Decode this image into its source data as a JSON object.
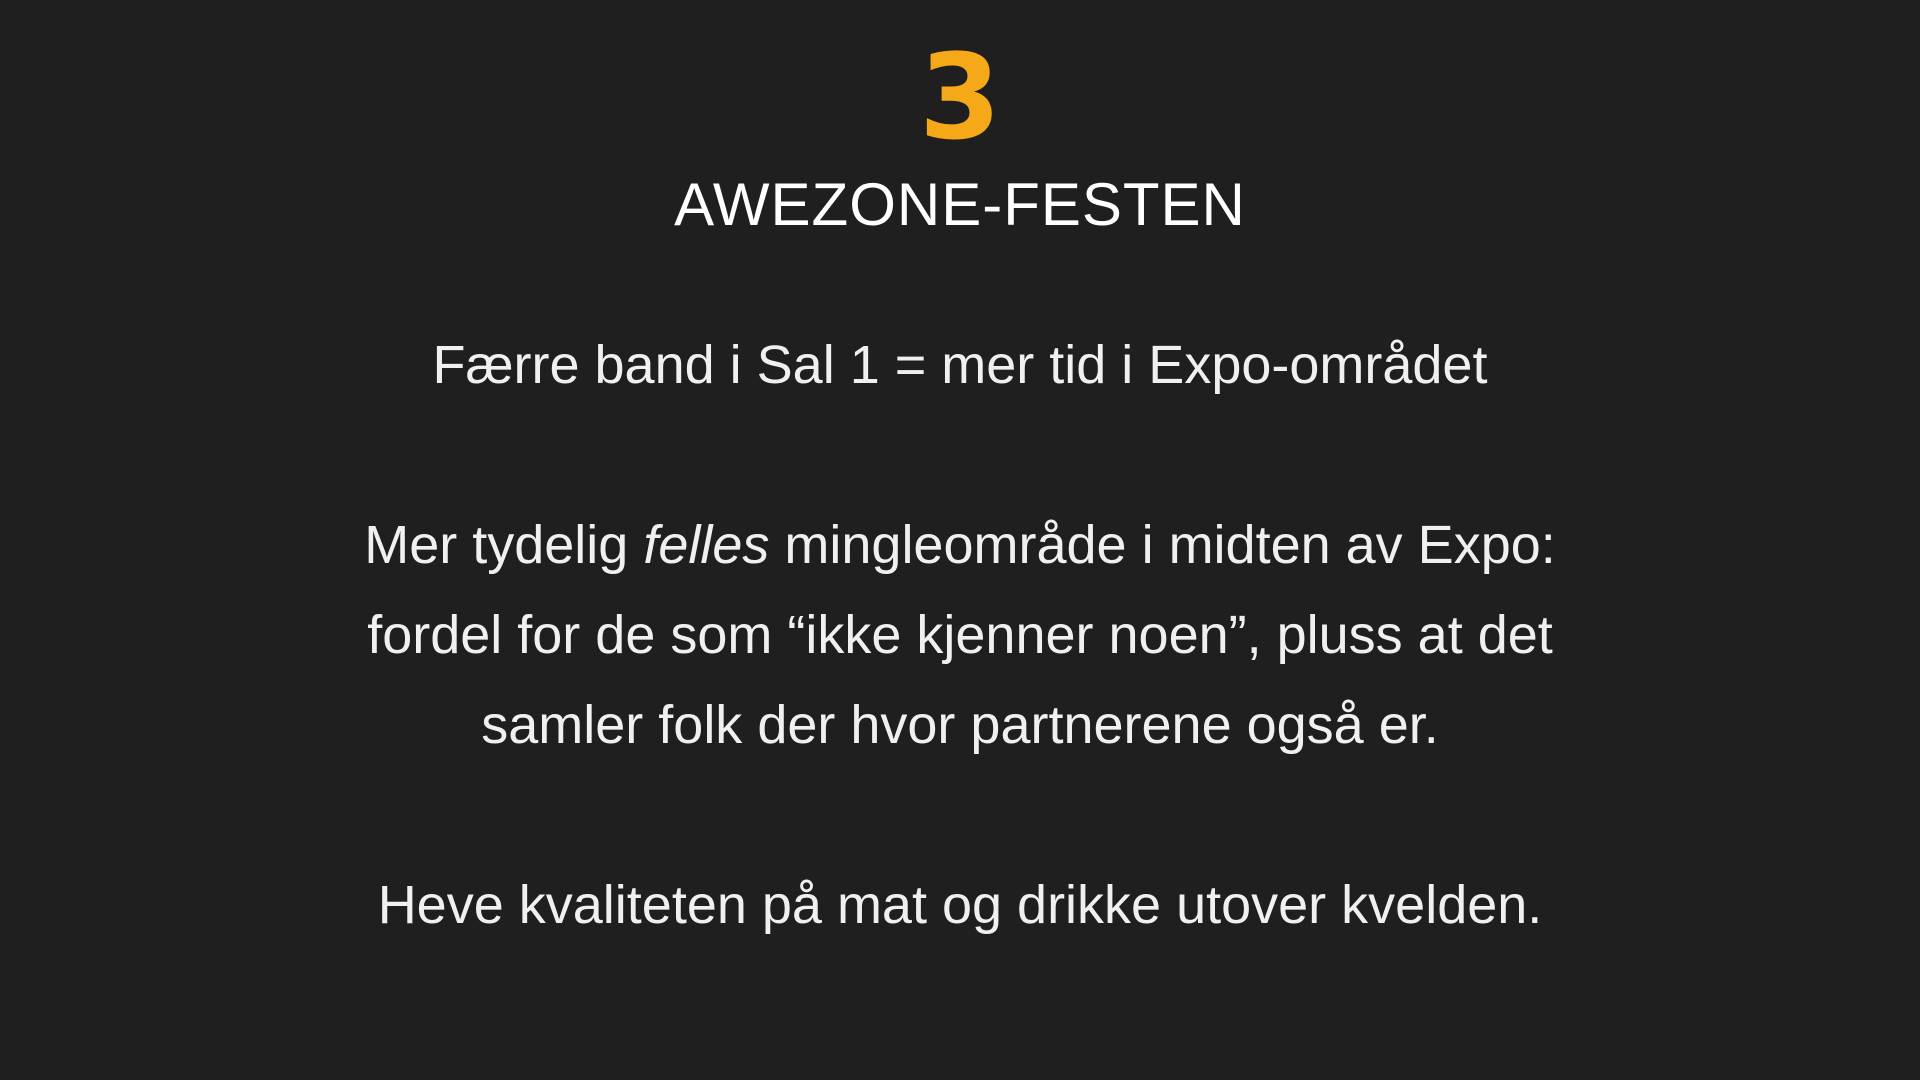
{
  "slide": {
    "number": "3",
    "title": "AWEZONE-FESTEN",
    "paragraphs": {
      "p1": "Færre band i Sal 1 = mer tid i Expo-området",
      "p2": {
        "line1_before": "Mer tydelig ",
        "line1_emphasis": "felles",
        "line1_after": " mingleområde i midten av Expo:",
        "line2": "fordel for de som “ikke kjenner noen”, pluss at det",
        "line3": "samler folk der hvor partnerene også er."
      },
      "p3": "Heve kvaliteten på mat og drikke utover kvelden."
    },
    "colors": {
      "background": "#1f1f1f",
      "accent": "#f5a818",
      "text": "#f0f0f0"
    }
  }
}
